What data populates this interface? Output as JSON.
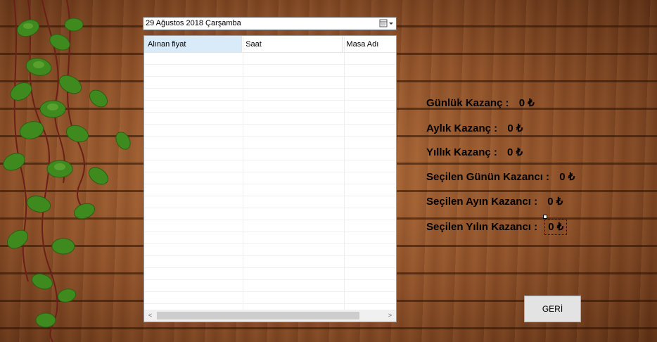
{
  "date_picker": {
    "value": "29 Ağustos 2018 Çarşamba"
  },
  "grid": {
    "columns": [
      "Alınan fiyat",
      "Saat",
      "Masa Adı"
    ],
    "scroll_left": "<",
    "scroll_right": ">"
  },
  "stats": {
    "gunluk": {
      "label": "Günlük Kazanç :",
      "value": "0 ₺"
    },
    "aylik": {
      "label": "Aylık Kazanç :",
      "value": "0 ₺"
    },
    "yillik": {
      "label": "Yıllık Kazanç :",
      "value": "0 ₺"
    },
    "secilen_gun": {
      "label": "Seçilen Günün Kazancı :",
      "value": "0 ₺"
    },
    "secilen_ay": {
      "label": "Seçilen Ayın Kazancı :",
      "value": "0 ₺"
    },
    "secilen_yil": {
      "label": "Seçilen Yılın Kazancı :",
      "value": "0 ₺"
    }
  },
  "buttons": {
    "geri": "GERİ"
  },
  "icons": {
    "calendar": "calendar-icon",
    "plant": "ivy-plant-decoration"
  }
}
